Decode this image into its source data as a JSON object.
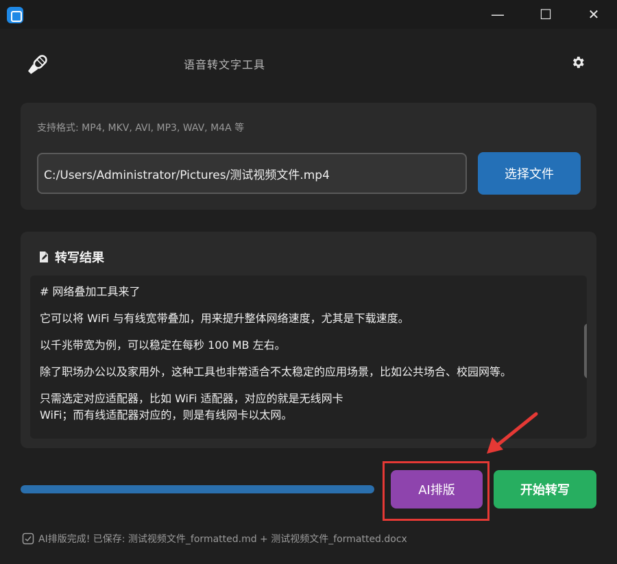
{
  "window": {
    "minimize_glyph": "—",
    "maximize_glyph": "☐",
    "close_glyph": "✕"
  },
  "header": {
    "title": "语音转文字工具",
    "logo_icon": "microphone-icon",
    "settings_icon": "gear-icon"
  },
  "file_panel": {
    "formats_label": "支持格式: MP4, MKV, AVI, MP3, WAV, M4A 等",
    "path_value": "C:/Users/Administrator/Pictures/测试视频文件.mp4",
    "choose_button": "选择文件"
  },
  "result": {
    "title": "转写结果",
    "paragraphs": [
      "# 网络叠加工具来了",
      "它可以将 WiFi 与有线宽带叠加，用来提升整体网络速度，尤其是下载速度。",
      "以千兆带宽为例，可以稳定在每秒 100 MB 左右。",
      "除了职场办公以及家用外，这种工具也非常适合不太稳定的应用场景，比如公共场合、校园网等。",
      "只需选定对应适配器，比如 WiFi 适配器，对应的就是无线网卡\nWiFi；而有线适配器对应的，则是有线网卡以太网。"
    ]
  },
  "progress": {
    "value_percent": 100
  },
  "buttons": {
    "ai_format": "AI排版",
    "start": "开始转写"
  },
  "status": {
    "text": "AI排版完成! 已保存: 测试视频文件_formatted.md + 测试视频文件_formatted.docx"
  },
  "colors": {
    "accent_blue": "#2470b7",
    "ai_purple": "#8e44ad",
    "start_green": "#27ae60",
    "highlight_red": "#e53935"
  }
}
